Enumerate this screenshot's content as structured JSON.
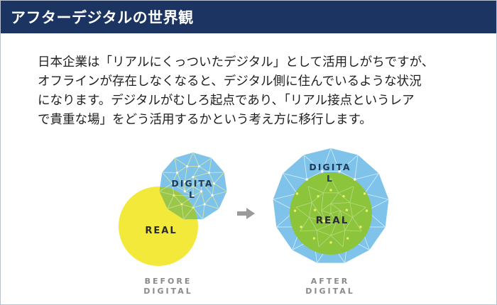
{
  "header": {
    "title": "アフターデジタルの世界観"
  },
  "body": {
    "lines": [
      "日本企業は「リアルにくっついたデジタル」として活用しがちですが、",
      "オフラインが存在しなくなると、デジタル側に住んでいるような状況",
      "になります。デジタルがむしろ起点であり、「リアル接点というレア",
      "で貴重な場」をどう活用するかという考え方に移行します。"
    ]
  },
  "diagram": {
    "before": {
      "digital_label_1": "DIGITA",
      "digital_label_2": "L",
      "real_label": "REAL",
      "caption_1": "BEFORE",
      "caption_2": "DIGITAL"
    },
    "after": {
      "digital_label_1": "DIGITA",
      "digital_label_2": "L",
      "real_label": "REAL",
      "caption_1": "AFTER",
      "caption_2": "DIGITAL"
    },
    "arrow_icon": "right-arrow-icon",
    "colors": {
      "header_bg": "#1c3461",
      "digital_blue": "#7fc3ea",
      "real_yellow": "#f2e93a",
      "real_green": "#8cc43c",
      "overlap_green": "#9ac74a",
      "arrow_gray": "#9a9a9a"
    }
  }
}
